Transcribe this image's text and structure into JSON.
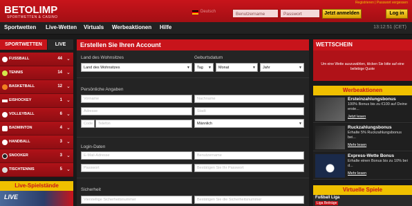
{
  "header": {
    "logo_text": "BETOLIMP",
    "logo_sub": "SPORTWETTEN & CASINO",
    "toplinks": "Registrieren | Passwort vergessen",
    "language": "Deutsch",
    "username_placeholder": "Benutzername",
    "password_placeholder": "Passwort",
    "register_label": "Jetzt anmelden",
    "login_label": "Log in"
  },
  "nav": {
    "items": [
      "Sportwetten",
      "Live-Wetten",
      "Virtuals",
      "Werbeaktionen",
      "Hilfe"
    ],
    "clock": "13:12:51 (CET)"
  },
  "sidebar": {
    "tab_sports": "SPORTWETTEN",
    "tab_live": "LIVE",
    "sports": [
      {
        "name": "FUSSBALL",
        "count": "44"
      },
      {
        "name": "TENNIS",
        "count": "14"
      },
      {
        "name": "BASKETBALL",
        "count": "12"
      },
      {
        "name": "EISHOCKEY",
        "count": "1"
      },
      {
        "name": "VOLLEYBALL",
        "count": "6"
      },
      {
        "name": "BADMINTON",
        "count": "4"
      },
      {
        "name": "HANDBALL",
        "count": "3"
      },
      {
        "name": "SNOOKER",
        "count": "3"
      },
      {
        "name": "TISCHTENNIS",
        "count": "5"
      }
    ],
    "promo_title": "Live-Spielstände",
    "promo_label": "LIVE"
  },
  "form": {
    "title": "Erstellen Sie Ihren Account",
    "country_label": "Land des Wohnsitzes",
    "country_value": "Land des Wohnsitzes",
    "dob_label": "Geburtsdatum",
    "dob_day": "Tag",
    "dob_month": "Monat",
    "dob_year": "Jahr",
    "personal_label": "Persönliche Angaben",
    "firstname": "Vorname",
    "lastname": "Nachname",
    "address": "Adresse",
    "city": "Stadt",
    "code": "Code",
    "phone": "Telefon",
    "gender": "Männlich",
    "login_label": "Login-Daten",
    "email": "E-Mail-Adresse",
    "username": "Benutzername",
    "password": "Passwort",
    "password_confirm": "Bestätigen Sie Ihr Passwort",
    "security_label": "Sicherheit",
    "security_code": "Vierstellige Sicherheitsnummer",
    "security_confirm": "Bestätigen Sie die Sicherheitsnummer"
  },
  "right": {
    "wettschein_title": "WETTSCHEIN",
    "wettschein_text": "Um eine Wette auszuwählen, klicken Sie bitte auf eine beliebige Quote",
    "werbeaktionen_title": "Werbeaktionen",
    "promos": [
      {
        "title": "Ersteinzahlungsbonus",
        "desc": "100% Bonus bis zu €100 auf Deine erste...",
        "more": "Jetzt lesen"
      },
      {
        "title": "Ruckzahlungsbonus",
        "desc": "Erhalte 5% Ruckzahlungsbonus bei...",
        "more": "Mehr lesen"
      },
      {
        "title": "Express-Wette Bonus",
        "desc": "Erhalte einen Bonus bis zu 10% bei d...",
        "more": "Mehr lesen"
      }
    ],
    "virtual_title": "Virtuelle Spiele",
    "virtual_item": "Fußball Liga",
    "virtual_badge": "Liga Beiträge"
  },
  "colors": {
    "brand_red": "#c8141b",
    "accent_yellow": "#f0c000"
  }
}
